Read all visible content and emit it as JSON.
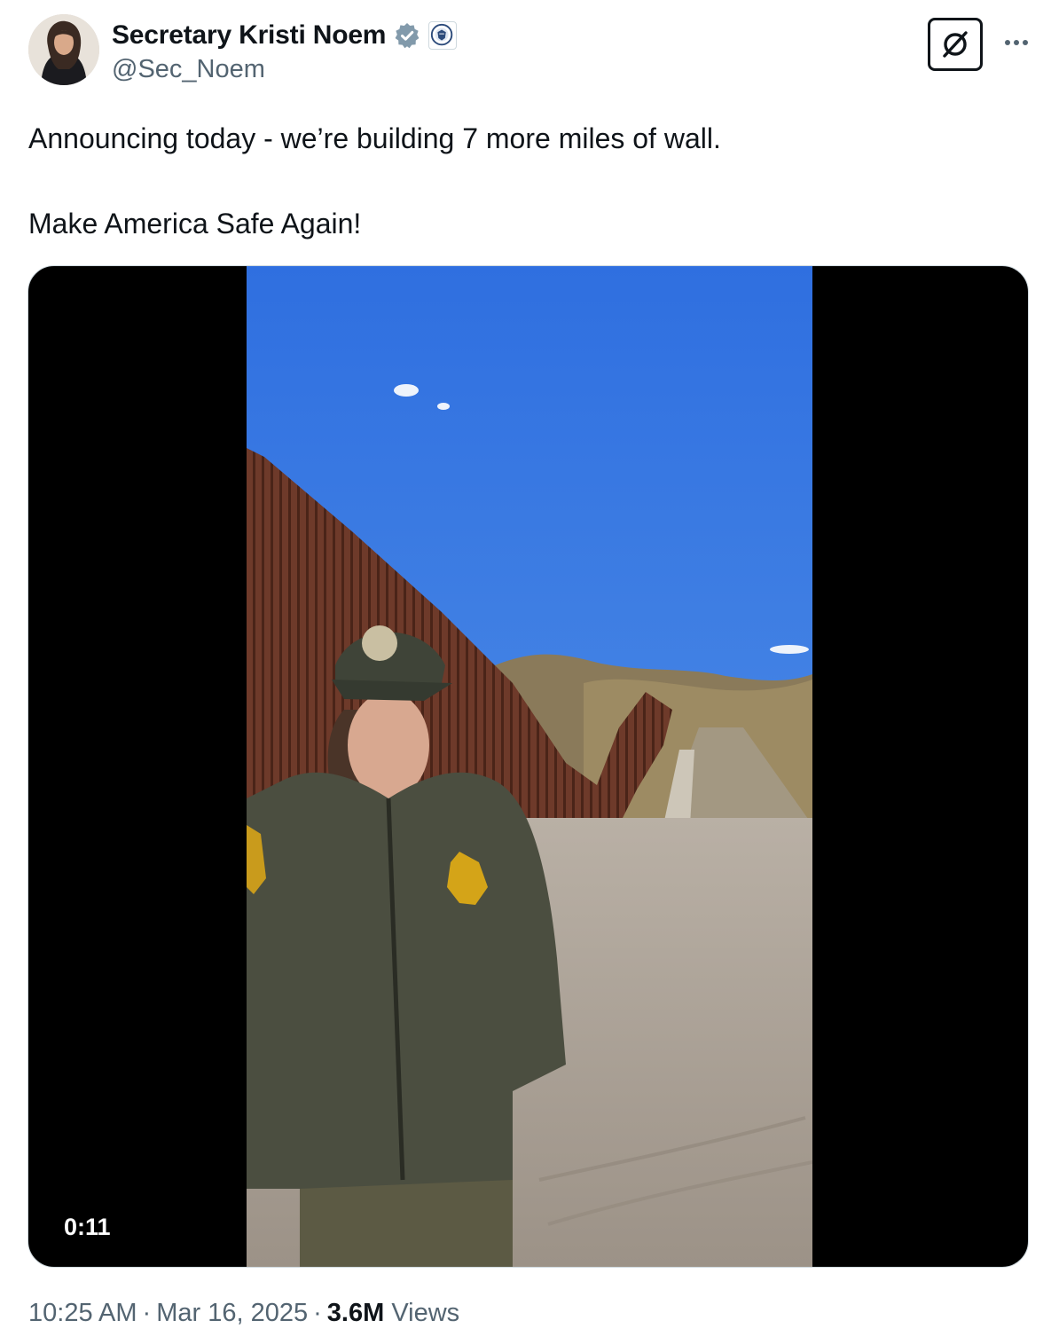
{
  "author": {
    "display_name": "Secretary Kristi Noem",
    "handle": "@Sec_Noem",
    "verified_badge_icon": "verified-badge-icon",
    "affiliation_icon": "dhs-seal-icon"
  },
  "header_actions": {
    "grok_icon": "grok-icon",
    "more_icon": "more-options-icon"
  },
  "tweet": {
    "text_lines": [
      "Announcing today - we’re building 7 more miles of wall.",
      "Make America Safe Again!"
    ]
  },
  "media": {
    "type": "video",
    "duration": "0:11"
  },
  "meta": {
    "time": "10:25 AM",
    "separator": "·",
    "date": "Mar 16, 2025",
    "views_count": "3.6M",
    "views_label": "Views"
  },
  "colors": {
    "text_primary": "#0f1419",
    "text_secondary": "#536471",
    "verified_blue": "#829aab",
    "border": "#cfd9de",
    "media_background": "#000000"
  }
}
